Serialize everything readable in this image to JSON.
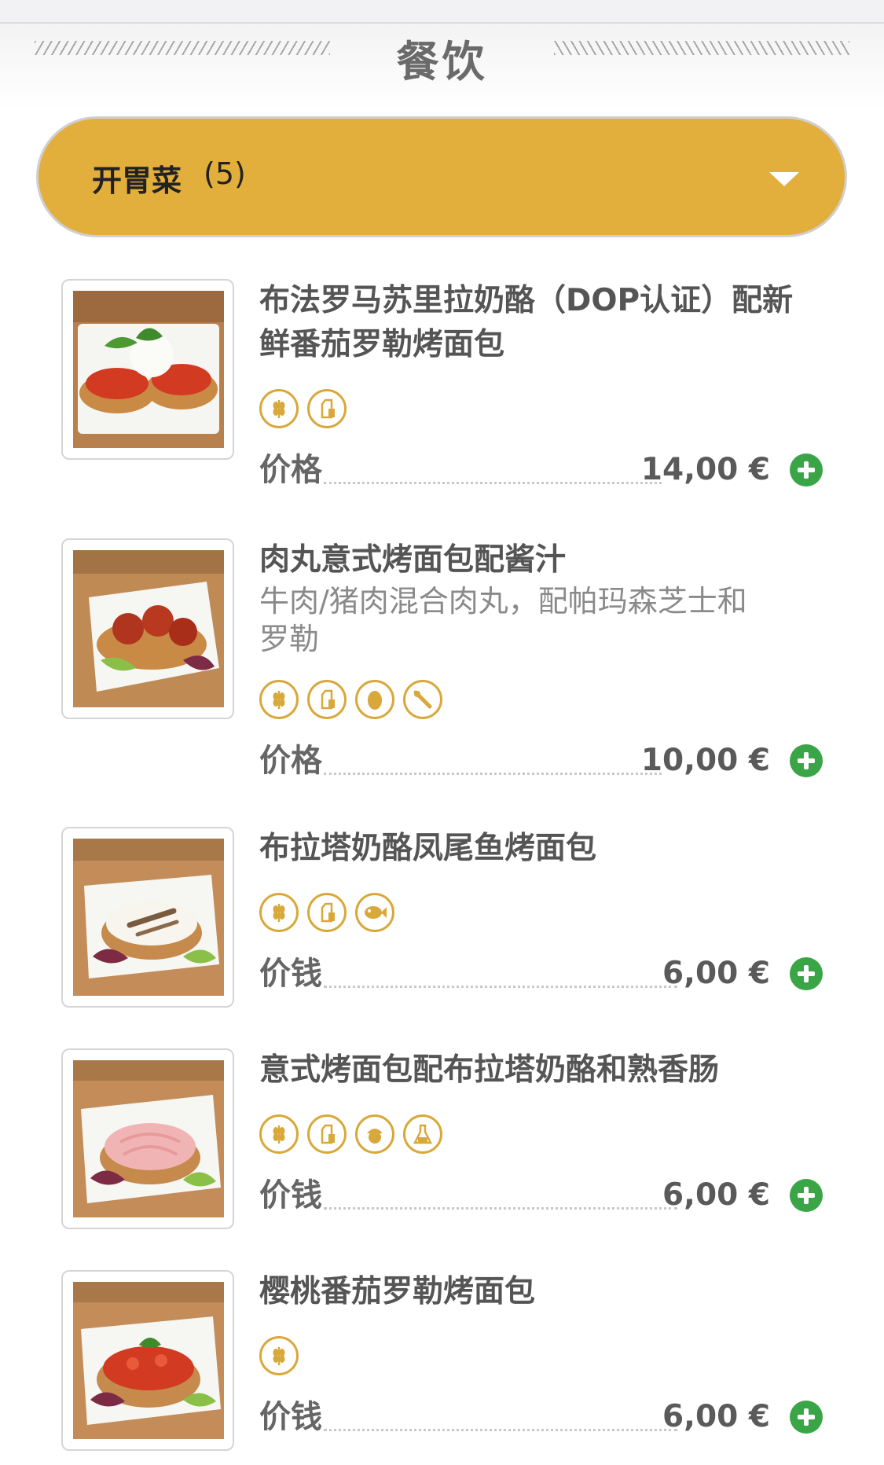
{
  "section": {
    "title": "餐饮"
  },
  "category": {
    "label": "开胃菜",
    "count": "(5)",
    "caret_icon": "chevron-down-icon"
  },
  "colors": {
    "accent": "#e3af3c",
    "add_button": "#3aa547",
    "allergen_ring": "#d9a83a"
  },
  "dishes": [
    {
      "name_line1": "布法罗马苏里拉奶酪（DOP认证）配新",
      "name_line2": "鲜番茄罗勒烤面包",
      "description_line1": "",
      "description_line2": "",
      "allergens": [
        "gluten-icon",
        "milk-icon"
      ],
      "price_label": "价格",
      "price": "14,00 €"
    },
    {
      "name_line1": "肉丸意式烤面包配酱汁",
      "name_line2": "",
      "description_line1": "牛肉/猪肉混合肉丸，配帕玛森芝士和",
      "description_line2": "罗勒",
      "allergens": [
        "gluten-icon",
        "milk-icon",
        "egg-icon",
        "celery-icon"
      ],
      "price_label": "价格",
      "price": "10,00 €"
    },
    {
      "name_line1": "布拉塔奶酪凤尾鱼烤面包",
      "name_line2": "",
      "description_line1": "",
      "description_line2": "",
      "allergens": [
        "gluten-icon",
        "milk-icon",
        "fish-icon"
      ],
      "price_label": "价钱",
      "price": "6,00 €"
    },
    {
      "name_line1": "意式烤面包配布拉塔奶酪和熟香肠",
      "name_line2": "",
      "description_line1": "",
      "description_line2": "",
      "allergens": [
        "gluten-icon",
        "milk-icon",
        "nuts-icon",
        "sulphites-icon"
      ],
      "price_label": "价钱",
      "price": "6,00 €"
    },
    {
      "name_line1": "樱桃番茄罗勒烤面包",
      "name_line2": "",
      "description_line1": "",
      "description_line2": "",
      "allergens": [
        "gluten-icon"
      ],
      "price_label": "价钱",
      "price": "6,00 €"
    }
  ]
}
